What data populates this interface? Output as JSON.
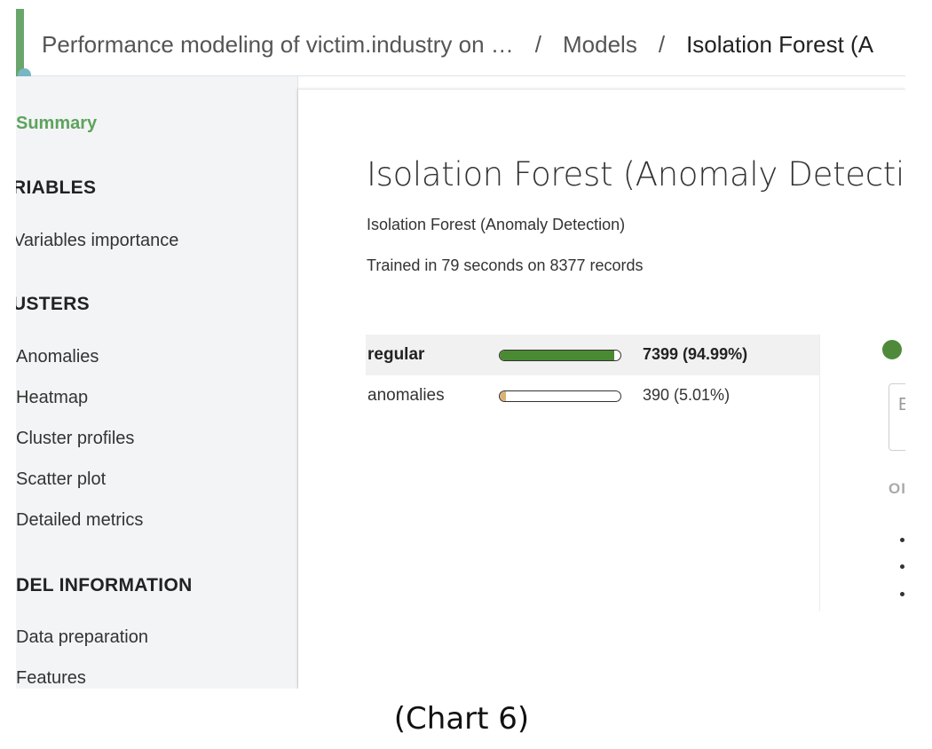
{
  "breadcrumb": {
    "project": "Performance modeling of victim.industry on …",
    "section": "Models",
    "current": "Isolation Forest (A",
    "separator": "/"
  },
  "sidebar": {
    "summary": "Summary",
    "variables_heading": "RIABLES",
    "variables_items": [
      "Variables importance"
    ],
    "clusters_heading": "USTERS",
    "clusters_items": [
      "Anomalies",
      "Heatmap",
      "Cluster profiles",
      "Scatter plot",
      "Detailed metrics"
    ],
    "model_info_heading": "DEL INFORMATION",
    "model_info_items": [
      "Data preparation",
      "Features"
    ]
  },
  "main": {
    "title": "Isolation Forest (Anomaly Detection)",
    "subtitle": "Isolation Forest (Anomaly Detection)",
    "training_info": "Trained in 79 seconds on 8377 records",
    "clusters": [
      {
        "name": "regular",
        "count_label": "7399 (94.99%)",
        "fraction": 0.9499,
        "color": "#4a8a32"
      },
      {
        "name": "anomalies",
        "count_label": "390 (5.01%)",
        "fraction": 0.0501,
        "color": "#d9b276"
      }
    ]
  },
  "right_panel": {
    "input_text": "E",
    "heading": "OI"
  },
  "caption": "(Chart 6)",
  "colors": {
    "accent": "#6aa56b",
    "summary_active": "#5da35f",
    "status_dot": "#4f8a3a"
  }
}
